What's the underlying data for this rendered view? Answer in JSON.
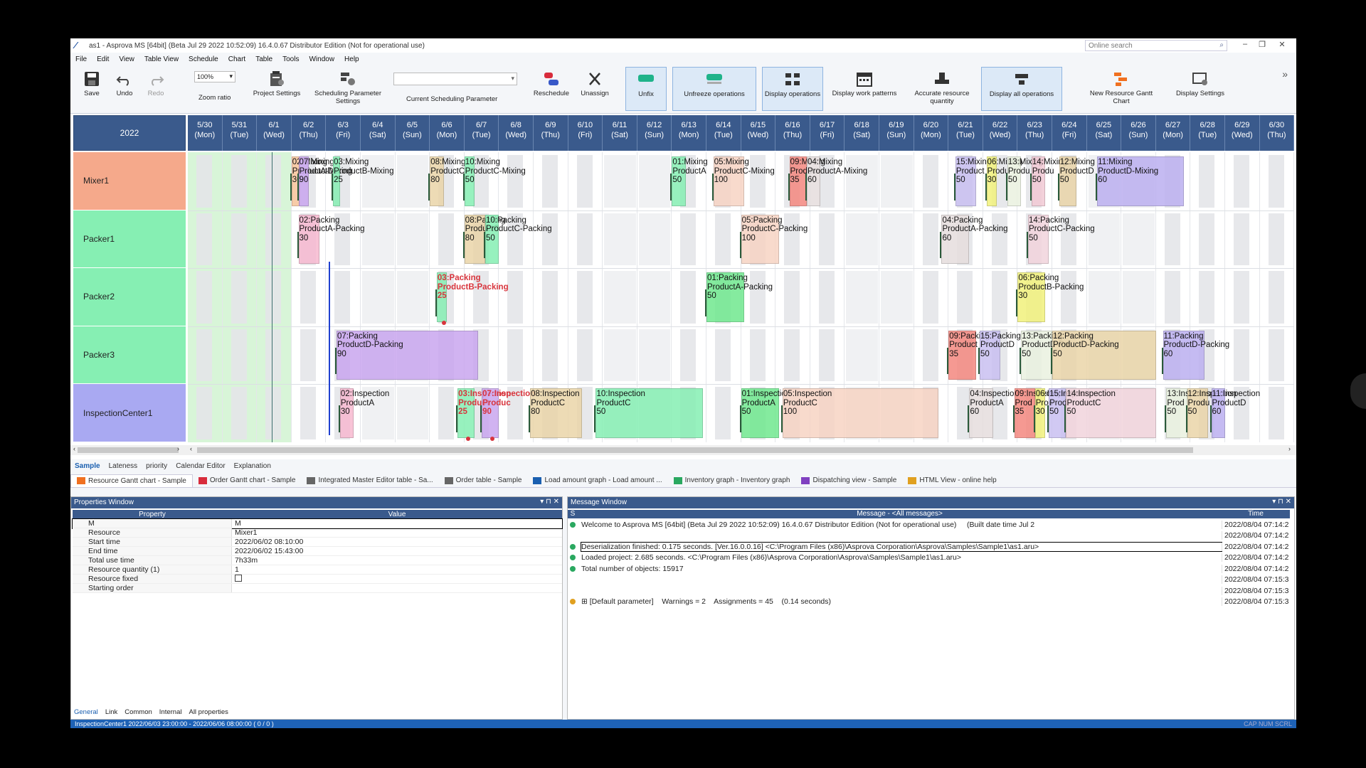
{
  "window": {
    "title": "as1 - Asprova MS [64bit] (Beta Jul 29 2022 10:52:09) 16.4.0.67 Distributor Edition (Not for operational use)",
    "search_placeholder": "Online search"
  },
  "menu": [
    "File",
    "Edit",
    "View",
    "Table View",
    "Schedule",
    "Chart",
    "Table",
    "Tools",
    "Window",
    "Help"
  ],
  "ribbon": {
    "save": "Save",
    "undo": "Undo",
    "redo": "Redo",
    "zoom_value": "100%",
    "zoom_ratio": "Zoom ratio",
    "project_settings": "Project Settings",
    "sched_param_settings": "Scheduling Parameter\nSettings",
    "current_sched_param": "Current Scheduling Parameter",
    "reschedule": "Reschedule",
    "unassign": "Unassign",
    "unfix": "Unfix",
    "unfreeze": "Unfreeze operations",
    "display_ops": "Display operations",
    "display_work": "Display work patterns",
    "accurate_res": "Accurate resource\nquantity",
    "display_all": "Display all operations",
    "new_res_gantt": "New Resource Gantt\nChart",
    "display_settings": "Display Settings"
  },
  "gantt": {
    "year": "2022",
    "dates": [
      [
        "5/30",
        "(Mon)"
      ],
      [
        "5/31",
        "(Tue)"
      ],
      [
        "6/1",
        "(Wed)"
      ],
      [
        "6/2",
        "(Thu)"
      ],
      [
        "6/3",
        "(Fri)"
      ],
      [
        "6/4",
        "(Sat)"
      ],
      [
        "6/5",
        "(Sun)"
      ],
      [
        "6/6",
        "(Mon)"
      ],
      [
        "6/7",
        "(Tue)"
      ],
      [
        "6/8",
        "(Wed)"
      ],
      [
        "6/9",
        "(Thu)"
      ],
      [
        "6/10",
        "(Fri)"
      ],
      [
        "6/11",
        "(Sat)"
      ],
      [
        "6/12",
        "(Sun)"
      ],
      [
        "6/13",
        "(Mon)"
      ],
      [
        "6/14",
        "(Tue)"
      ],
      [
        "6/15",
        "(Wed)"
      ],
      [
        "6/16",
        "(Thu)"
      ],
      [
        "6/17",
        "(Fri)"
      ],
      [
        "6/18",
        "(Sat)"
      ],
      [
        "6/19",
        "(Sun)"
      ],
      [
        "6/20",
        "(Mon)"
      ],
      [
        "6/21",
        "(Tue)"
      ],
      [
        "6/22",
        "(Wed)"
      ],
      [
        "6/23",
        "(Thu)"
      ],
      [
        "6/24",
        "(Fri)"
      ],
      [
        "6/25",
        "(Sat)"
      ],
      [
        "6/26",
        "(Sun)"
      ],
      [
        "6/27",
        "(Mon)"
      ],
      [
        "6/28",
        "(Tue)"
      ],
      [
        "6/29",
        "(Wed)"
      ],
      [
        "6/30",
        "(Thu)"
      ]
    ],
    "resources": [
      {
        "name": "Mixer1",
        "color": "#f5a98b"
      },
      {
        "name": "Packer1",
        "color": "#86efb3"
      },
      {
        "name": "Packer2",
        "color": "#86efb3"
      },
      {
        "name": "Packer3",
        "color": "#86efb3"
      },
      {
        "name": "InspectionCenter1",
        "color": "#a9a9f2"
      }
    ],
    "operations": [
      {
        "row": 0,
        "d": 3.0,
        "w": 0.25,
        "c": "#f6c39a",
        "label": "02:Mixing\nProductA-Mixing\n30"
      },
      {
        "row": 0,
        "d": 3.2,
        "w": 0.3,
        "c": "#c9a6ef",
        "label": "07:Mixing\nProductD\n90"
      },
      {
        "row": 0,
        "d": 4.2,
        "w": 0.2,
        "c": "#86efb3",
        "label": "03:Mixing\nProductB-Mixing\n25"
      },
      {
        "row": 0,
        "d": 7.0,
        "w": 0.4,
        "c": "#ead5a9",
        "label": "08:Mixing\nProductC\n80"
      },
      {
        "row": 0,
        "d": 8.0,
        "w": 0.3,
        "c": "#86efb3",
        "label": "10:Mixing\nProductC-Mixing\n50"
      },
      {
        "row": 0,
        "d": 14.0,
        "w": 0.4,
        "c": "#86efb3",
        "label": "01:Mixing\nProductA\n50"
      },
      {
        "row": 0,
        "d": 15.2,
        "w": 0.9,
        "c": "#f7d4c4",
        "label": "05:Mixing\nProductC-Mixing\n100"
      },
      {
        "row": 0,
        "d": 17.4,
        "w": 0.5,
        "c": "#f4887f",
        "label": "09:Mixing\nProduct\n35"
      },
      {
        "row": 0,
        "d": 17.9,
        "w": 0.4,
        "c": "#e6dede",
        "label": "04:Mixing\nProductA-Mixing\n60"
      },
      {
        "row": 0,
        "d": 22.2,
        "w": 0.6,
        "c": "#c9c0f2",
        "label": "15:Mixing\nProduct\n50"
      },
      {
        "row": 0,
        "d": 23.1,
        "w": 0.3,
        "c": "#f2f27c",
        "label": "06:Mixing\nProdu\n30"
      },
      {
        "row": 0,
        "d": 23.7,
        "w": 0.4,
        "c": "#eaf2e0",
        "label": "13:Mixing\nProdu\n50"
      },
      {
        "row": 0,
        "d": 24.4,
        "w": 0.4,
        "c": "#f2c9d4",
        "label": "14:Mixing\nProdu\n50"
      },
      {
        "row": 0,
        "d": 25.2,
        "w": 0.5,
        "c": "#ead5a9",
        "label": "12:Mixing\nProductD\n50"
      },
      {
        "row": 0,
        "d": 26.3,
        "w": 2.5,
        "c": "#bcb0f0",
        "label": "11:Mixing\nProductD-Mixing\n60"
      },
      {
        "row": 1,
        "d": 3.2,
        "w": 0.6,
        "c": "#f7b9d0",
        "label": "02:Packing\nProductA-Packing\n30"
      },
      {
        "row": 1,
        "d": 8.0,
        "w": 0.6,
        "c": "#ead5a9",
        "label": "08:Packing\nProductC\n80"
      },
      {
        "row": 1,
        "d": 8.6,
        "w": 0.4,
        "c": "#86efb3",
        "label": "10:Packing\nProductC-Packing\n50"
      },
      {
        "row": 1,
        "d": 16.0,
        "w": 1.1,
        "c": "#f7d4c4",
        "label": "05:Packing\nProductC-Packing\n100"
      },
      {
        "row": 1,
        "d": 21.8,
        "w": 0.8,
        "c": "#e6dede",
        "label": "04:Packing\nProductA-Packing\n60"
      },
      {
        "row": 1,
        "d": 24.3,
        "w": 0.6,
        "c": "#f2d4dc",
        "label": "14:Packing\nProductC-Packing\n50"
      },
      {
        "row": 2,
        "d": 7.2,
        "w": 0.3,
        "c": "#86efb3",
        "label": "03:Packing\nProductB-Packing\n25",
        "red": true
      },
      {
        "row": 2,
        "d": 15.0,
        "w": 1.1,
        "c": "#70e88f",
        "label": "01:Packing\nProductA-Packing\n50"
      },
      {
        "row": 2,
        "d": 24.0,
        "w": 0.8,
        "c": "#f2f27c",
        "label": "06:Packing\nProductB-Packing\n30"
      },
      {
        "row": 3,
        "d": 4.3,
        "w": 4.1,
        "c": "#c9a6ef",
        "label": "07:Packing\nProductD-Packing\n90"
      },
      {
        "row": 3,
        "d": 22.0,
        "w": 0.8,
        "c": "#f4887f",
        "label": "09:Packing\nProduct\n35"
      },
      {
        "row": 3,
        "d": 22.9,
        "w": 0.6,
        "c": "#c9c0f2",
        "label": "15:Packing\nProductD\n50"
      },
      {
        "row": 3,
        "d": 24.1,
        "w": 0.9,
        "c": "#eaf2e0",
        "label": "13:Packing\nProductD-Pa\n50"
      },
      {
        "row": 3,
        "d": 25.0,
        "w": 3.0,
        "c": "#ead5a9",
        "label": "12:Packing\nProductD-Packing\n50"
      },
      {
        "row": 3,
        "d": 28.2,
        "w": 1.2,
        "c": "#bcb0f0",
        "label": "11:Packing\nProductD-Packing\n60"
      },
      {
        "row": 4,
        "d": 4.4,
        "w": 0.4,
        "c": "#f7b9d0",
        "label": "02:Inspection\nProductA\n30"
      },
      {
        "row": 4,
        "d": 7.8,
        "w": 0.5,
        "c": "#86efb3",
        "label": "03:Inspection\nProduct\n25",
        "red": true
      },
      {
        "row": 4,
        "d": 8.5,
        "w": 0.5,
        "c": "#c9a6ef",
        "label": "07:Inspection\nProduc\n90",
        "red": true
      },
      {
        "row": 4,
        "d": 9.9,
        "w": 1.5,
        "c": "#ead5a9",
        "label": "08:Inspection\nProductC\n80"
      },
      {
        "row": 4,
        "d": 11.8,
        "w": 3.1,
        "c": "#86efb3",
        "label": "10:Inspection\nProductC\n50"
      },
      {
        "row": 4,
        "d": 16.0,
        "w": 1.1,
        "c": "#70e88f",
        "label": "01:Inspection\nProductA\n50"
      },
      {
        "row": 4,
        "d": 17.2,
        "w": 4.5,
        "c": "#f7d4c4",
        "label": "05:Inspection\nProductC\n100"
      },
      {
        "row": 4,
        "d": 22.6,
        "w": 0.7,
        "c": "#e6dede",
        "label": "04:Inspection\nProductA\n60"
      },
      {
        "row": 4,
        "d": 23.9,
        "w": 0.6,
        "c": "#f4887f",
        "label": "09:Inspection\nProd\n35"
      },
      {
        "row": 4,
        "d": 24.5,
        "w": 0.3,
        "c": "#f2f27c",
        "label": "06:Inspection\nProd\n30"
      },
      {
        "row": 4,
        "d": 24.9,
        "w": 0.5,
        "c": "#c9c0f2",
        "label": "15:Inspection\nProd\n50"
      },
      {
        "row": 4,
        "d": 25.4,
        "w": 2.6,
        "c": "#f2d4dc",
        "label": "14:Inspection\nProductC\n50"
      },
      {
        "row": 4,
        "d": 28.3,
        "w": 0.6,
        "c": "#eaf2e0",
        "label": "13:Inspection\nProd\n50"
      },
      {
        "row": 4,
        "d": 28.9,
        "w": 0.6,
        "c": "#ead5a9",
        "label": "12:Inspection\nProdu\n50"
      },
      {
        "row": 4,
        "d": 29.6,
        "w": 0.4,
        "c": "#bcb0f0",
        "label": "11:Inspection\nProductD\n60"
      }
    ]
  },
  "tabs1": [
    "Sample",
    "Lateness",
    "priority",
    "Calendar Editor",
    "Explanation"
  ],
  "tabs2": [
    "Resource Gantt chart - Sample",
    "Order Gantt chart - Sample",
    "Integrated Master Editor table - Sa...",
    "Order table - Sample",
    "Load amount graph - Load amount ...",
    "Inventory graph - Inventory graph",
    "Dispatching view - Sample",
    "HTML View - online help"
  ],
  "properties": {
    "title": "Properties Window",
    "col_property": "Property",
    "col_value": "Value",
    "rows": [
      [
        "M",
        "M"
      ],
      [
        "Resource",
        "Mixer1"
      ],
      [
        "Start time",
        "2022/06/02 08:10:00"
      ],
      [
        "End time",
        "2022/06/02 15:43:00"
      ],
      [
        "Total use time",
        "7h33m"
      ],
      [
        "Resource quantity (1)",
        "1"
      ],
      [
        "Resource fixed",
        ""
      ],
      [
        "Starting order",
        ""
      ]
    ],
    "tabs": [
      "General",
      "Link",
      "Common",
      "Internal",
      "All properties"
    ]
  },
  "messages": {
    "title": "Message Window",
    "col_s": "S",
    "col_message": "Message - <All messages>",
    "col_time": "Time",
    "rows": [
      {
        "text": "Welcome to Asprova MS [64bit] (Beta Jul 29 2022 10:52:09) 16.4.0.67 Distributor Edition (Not for operational use)     (Built date time Jul 2",
        "time": "2022/08/04 07:14:2",
        "c": "#2aa860"
      },
      {
        "text": "",
        "time": "2022/08/04 07:14:2",
        "c": ""
      },
      {
        "text": "Deserialization finished: 0.175 seconds. [Ver.16.0.0.16] <C:\\Program Files (x86)\\Asprova Corporation\\Asprova\\Samples\\Sample1\\as1.aru>",
        "time": "2022/08/04 07:14:2",
        "c": "#2aa860"
      },
      {
        "text": "Loaded project: 2.685 seconds. <C:\\Program Files (x86)\\Asprova Corporation\\Asprova\\Samples\\Sample1\\as1.aru>",
        "time": "2022/08/04 07:14:2",
        "c": "#2aa860"
      },
      {
        "text": "Total number of objects: 15917",
        "time": "2022/08/04 07:14:2",
        "c": "#2aa860"
      },
      {
        "text": "",
        "time": "2022/08/04 07:15:3",
        "c": ""
      },
      {
        "text": "",
        "time": "2022/08/04 07:15:3",
        "c": ""
      },
      {
        "text": "⊞ [Default parameter]    Warnings = 2    Assignments = 45    (0.14 seconds)",
        "time": "2022/08/04 07:15:3",
        "c": "#e0a020"
      }
    ]
  },
  "status": {
    "text": "InspectionCenter1 2022/06/03 23:00:00 - 2022/06/06 08:00:00 ( 0 / 0 )",
    "caps": "CAP  NUM  SCRL"
  }
}
